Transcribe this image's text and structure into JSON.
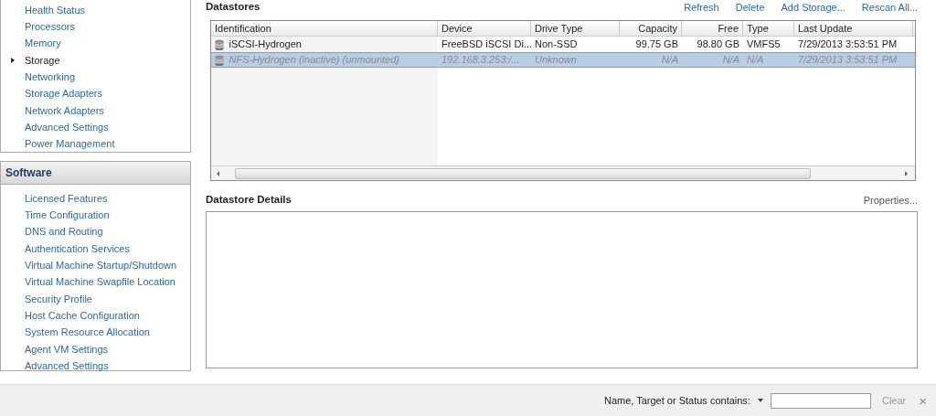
{
  "hardware": {
    "items": [
      {
        "label": "Health Status",
        "selected": false
      },
      {
        "label": "Processors",
        "selected": false
      },
      {
        "label": "Memory",
        "selected": false
      },
      {
        "label": "Storage",
        "selected": true
      },
      {
        "label": "Networking",
        "selected": false
      },
      {
        "label": "Storage Adapters",
        "selected": false
      },
      {
        "label": "Network Adapters",
        "selected": false
      },
      {
        "label": "Advanced Settings",
        "selected": false
      },
      {
        "label": "Power Management",
        "selected": false
      }
    ]
  },
  "software": {
    "title": "Software",
    "items": [
      {
        "label": "Licensed Features",
        "selected": false
      },
      {
        "label": "Time Configuration",
        "selected": false
      },
      {
        "label": "DNS and Routing",
        "selected": false
      },
      {
        "label": "Authentication Services",
        "selected": false
      },
      {
        "label": "Virtual Machine Startup/Shutdown",
        "selected": false
      },
      {
        "label": "Virtual Machine Swapfile Location",
        "selected": false
      },
      {
        "label": "Security Profile",
        "selected": false
      },
      {
        "label": "Host Cache Configuration",
        "selected": false
      },
      {
        "label": "System Resource Allocation",
        "selected": false
      },
      {
        "label": "Agent VM Settings",
        "selected": false
      },
      {
        "label": "Advanced Settings",
        "selected": false
      }
    ]
  },
  "datastores": {
    "title": "Datastores",
    "actions": [
      "Refresh",
      "Delete",
      "Add Storage...",
      "Rescan All..."
    ],
    "columns": [
      "Identification",
      "Device",
      "Drive Type",
      "Capacity",
      "Free",
      "Type",
      "Last Update"
    ],
    "rows": [
      {
        "cells": [
          "iSCSI-Hydrogen",
          "FreeBSD iSCSI Di...",
          "Non-SSD",
          "99.75 GB",
          "98.80 GB",
          "VMFS5",
          "7/29/2013 3:53:51 PM"
        ],
        "selected": false,
        "inactive": false
      },
      {
        "cells": [
          "NFS-Hydrogen (inactive) (unmounted)",
          "192.168.3.253:/...",
          "Unknown",
          "N/A",
          "N/A",
          "N/A",
          "7/29/2013 3:53:51 PM"
        ],
        "selected": true,
        "inactive": true
      }
    ]
  },
  "details": {
    "title": "Datastore Details",
    "action": "Properties..."
  },
  "filter": {
    "label": "Name, Target or Status contains:",
    "clear": "Clear",
    "close": "×"
  }
}
